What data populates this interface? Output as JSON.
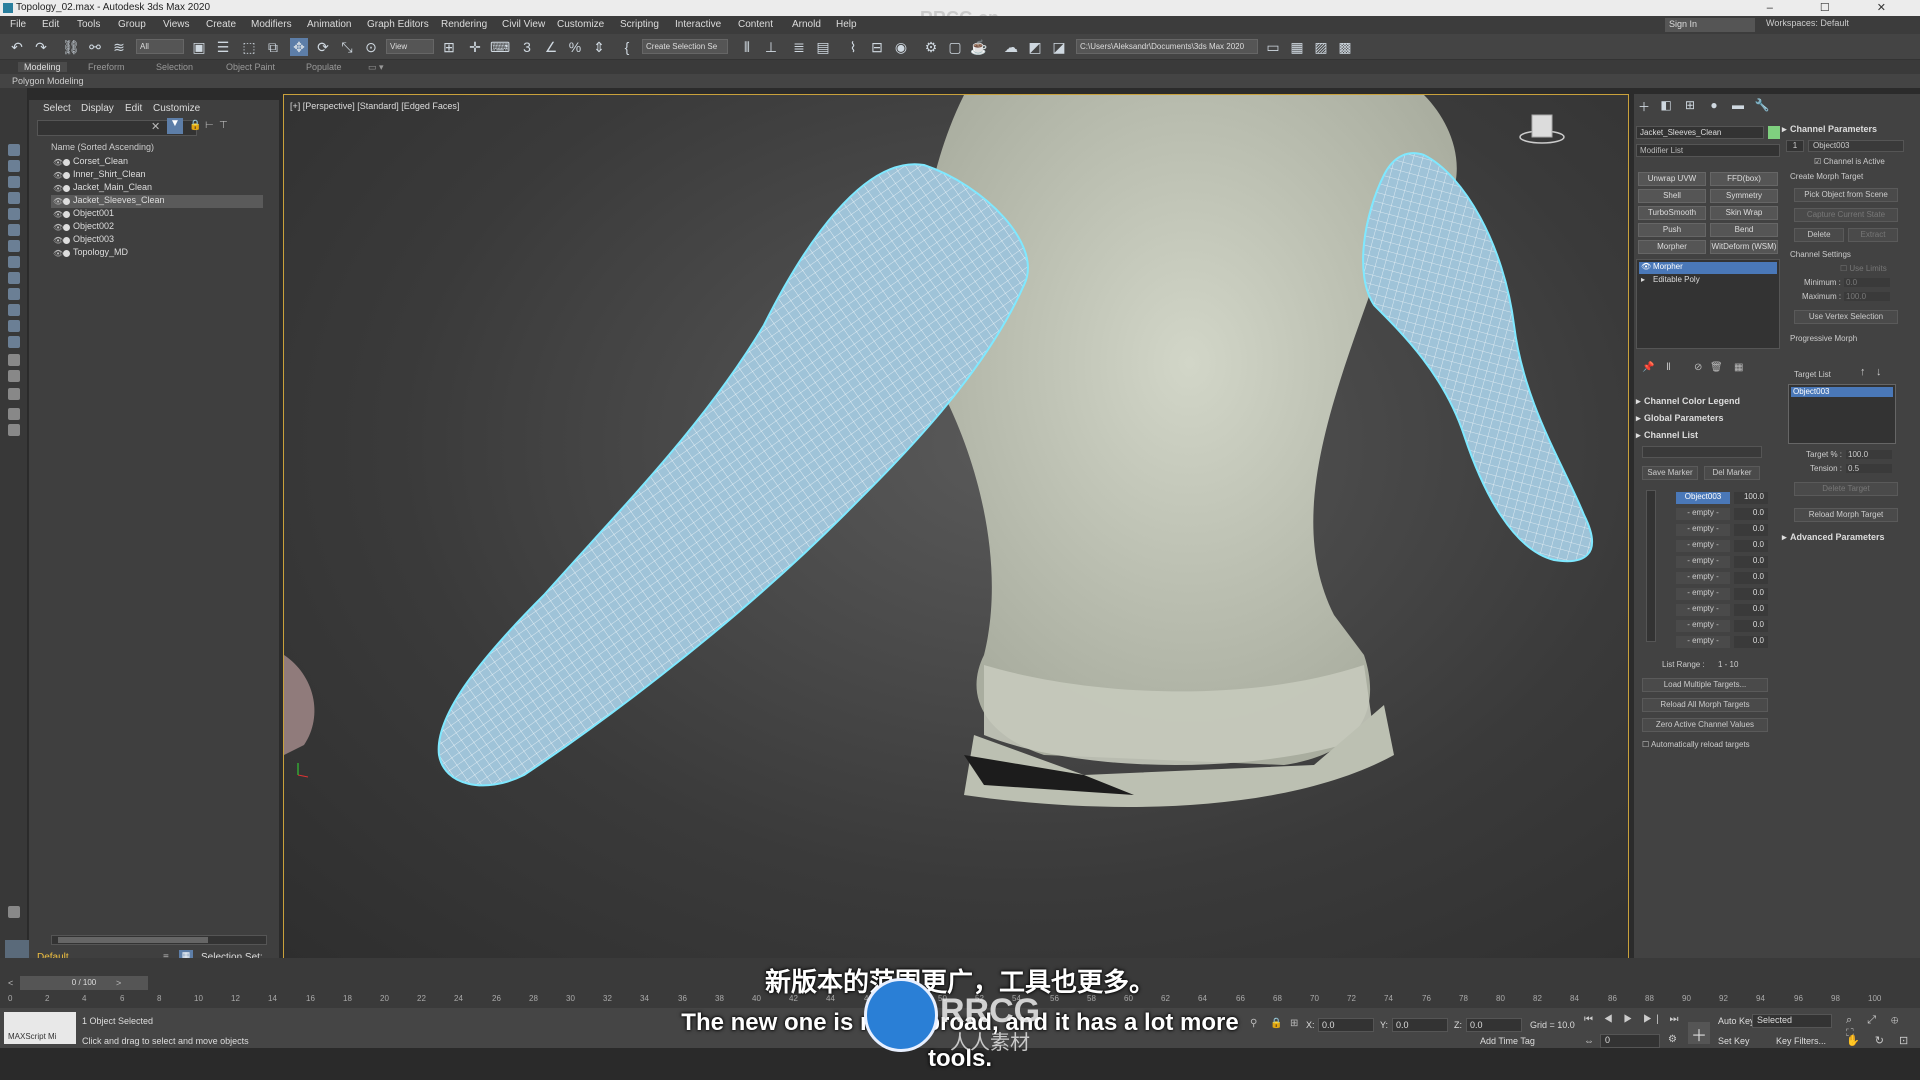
{
  "window": {
    "title": "Topology_02.max - Autodesk 3ds Max 2020",
    "controls": "–  ☐  ✕"
  },
  "menu": {
    "items": [
      "File",
      "Edit",
      "Tools",
      "Group",
      "Views",
      "Create",
      "Modifiers",
      "Animation",
      "Graph Editors",
      "Rendering",
      "Civil View",
      "Customize",
      "Scripting",
      "Interactive",
      "Content",
      "Arnold",
      "Help"
    ],
    "signin": "Sign In",
    "workspace": "Workspaces:  Default"
  },
  "toolbar": {
    "filter": "All",
    "refcoord": "View",
    "selection_set": "Create Selection Se",
    "path": "C:\\Users\\Aleksandr\\Documents\\3ds Max 2020"
  },
  "ribbon": {
    "tabs": [
      "Modeling",
      "Freeform",
      "Selection",
      "Object Paint",
      "Populate"
    ],
    "sub": "Polygon Modeling"
  },
  "scene_explorer": {
    "menu": [
      "Select",
      "Display",
      "Edit",
      "Customize"
    ],
    "header": "Name (Sorted Ascending)",
    "objects": [
      "Corset_Clean",
      "Inner_Shirt_Clean",
      "Jacket_Main_Clean",
      "Jacket_Sleeves_Clean",
      "Object001",
      "Object002",
      "Object003",
      "Topology_MD"
    ],
    "layer": "Default",
    "selection_set": "Selection Set:"
  },
  "viewport": {
    "label": "[+] [Perspective] [Standard] [Edged Faces]"
  },
  "command_panel": {
    "object_name": "Jacket_Sleeves_Clean",
    "modifier_list": "Modifier List",
    "mod_buttons": [
      "Unwrap UVW",
      "FFD(box)",
      "Shell",
      "Symmetry",
      "TurboSmooth",
      "Skin Wrap",
      "Push",
      "Bend",
      "Morpher",
      "WitDeform (WSM)"
    ],
    "stack": [
      "Morpher",
      "Editable Poly"
    ],
    "rollouts": [
      "Channel Color Legend",
      "Global Parameters",
      "Channel List"
    ],
    "save_marker": "Save Marker",
    "del_marker": "Del Marker",
    "channels": [
      {
        "name": "Object003",
        "value": "100.0"
      },
      {
        "name": "- empty -",
        "value": "0.0"
      },
      {
        "name": "- empty -",
        "value": "0.0"
      },
      {
        "name": "- empty -",
        "value": "0.0"
      },
      {
        "name": "- empty -",
        "value": "0.0"
      },
      {
        "name": "- empty -",
        "value": "0.0"
      },
      {
        "name": "- empty -",
        "value": "0.0"
      },
      {
        "name": "- empty -",
        "value": "0.0"
      },
      {
        "name": "- empty -",
        "value": "0.0"
      },
      {
        "name": "- empty -",
        "value": "0.0"
      }
    ],
    "list_range_label": "List Range :",
    "list_range": "1 - 10",
    "bottom_buttons": [
      "Load Multiple Targets...",
      "Reload All Morph Targets",
      "Zero Active Channel Values"
    ],
    "auto_reload": "Automatically reload targets",
    "channel_params": {
      "title": "Channel Parameters",
      "index": "1",
      "channel_name": "Object003",
      "channel_active": "Channel is Active",
      "create_morph_target": "Create Morph Target",
      "pick_object": "Pick Object from Scene",
      "capture_state": "Capture Current State",
      "delete": "Delete",
      "extract": "Extract",
      "channel_settings": "Channel Settings",
      "use_limits": "Use Limits",
      "minimum_label": "Minimum :",
      "minimum": "0.0",
      "maximum_label": "Maximum :",
      "maximum": "100.0",
      "use_vertex_selection": "Use Vertex Selection",
      "progressive_morph": "Progressive Morph",
      "target_list": "Target List",
      "target_item": "Object003",
      "target_pct_label": "Target % :",
      "target_pct": "100.0",
      "tension_label": "Tension :",
      "tension": "0.5",
      "delete_target": "Delete Target",
      "reload_morph_target": "Reload Morph Target",
      "advanced": "Advanced Parameters"
    }
  },
  "timeline": {
    "frame": "0 / 100",
    "ticks": [
      "0",
      "2",
      "4",
      "6",
      "8",
      "10",
      "12",
      "14",
      "16",
      "18",
      "20",
      "22",
      "24",
      "26",
      "28",
      "30",
      "32",
      "34",
      "36",
      "38",
      "40",
      "42",
      "44",
      "46",
      "48",
      "50",
      "52",
      "54",
      "56",
      "58",
      "60",
      "62",
      "64",
      "66",
      "68",
      "70",
      "72",
      "74",
      "76",
      "78",
      "80",
      "82",
      "84",
      "86",
      "88",
      "90",
      "92",
      "94",
      "96",
      "98",
      "100"
    ]
  },
  "status": {
    "maxscript": "MAXScript Mi",
    "selected": "1 Object Selected",
    "hint": "Click and drag to select and move objects",
    "x_label": "X:",
    "x": "0.0",
    "y_label": "Y:",
    "y": "0.0",
    "z_label": "Z:",
    "z": "0.0",
    "grid": "Grid = 10.0",
    "add_time_tag": "Add Time Tag",
    "auto_key": "Auto Key",
    "set_key": "Set Key",
    "key_mode": "Selected",
    "key_filters": "Key Filters...",
    "current_frame": "0"
  },
  "subtitles": {
    "cn": "新版本的范围更广，工具也更多。",
    "en": "The new one is more broad, and it has a lot more tools."
  },
  "watermarks": {
    "top": "RRCG.cn",
    "logo": "RRCG",
    "logo_sub": "人人素材"
  },
  "colors": {
    "accent": "#4a78b8",
    "viewport_border": "#c9a13b",
    "wire": "#7fe8ff",
    "sleeve": "#9fc3d8",
    "jacket": "#c9cdbf"
  }
}
